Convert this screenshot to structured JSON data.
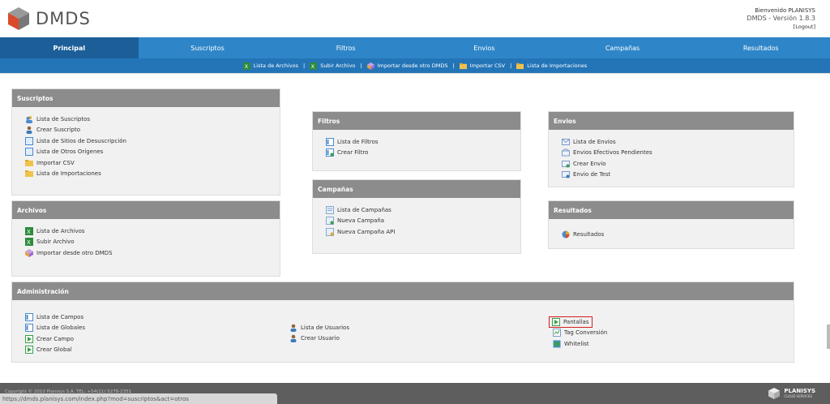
{
  "header": {
    "app_name": "DMDS",
    "welcome": "Bienvenido PLANISYS",
    "version": "DMDS - Versión 1.8.3",
    "logout": "[Logout]"
  },
  "tabs": [
    {
      "label": "Principal",
      "active": true
    },
    {
      "label": "Suscriptos"
    },
    {
      "label": "Filtros"
    },
    {
      "label": "Envios"
    },
    {
      "label": "Campañas"
    },
    {
      "label": "Resultados"
    }
  ],
  "subnav": [
    {
      "label": "Lista de Archivos",
      "icon": "excel-icon"
    },
    {
      "label": "Subir Archivo",
      "icon": "excel-upload-icon"
    },
    {
      "label": "Importar desde otro DMDS",
      "icon": "box-icon"
    },
    {
      "label": "Importar CSV",
      "icon": "folder-icon"
    },
    {
      "label": "Lista de Importaciones",
      "icon": "folder-icon"
    }
  ],
  "suscriptos": {
    "title": "Suscriptos",
    "items": [
      "Lista de Suscriptos",
      "Crear Suscripto",
      "Lista de Sitios de Desuscripción",
      "Lista de Otros Orígenes",
      "Importar CSV",
      "Lista de Importaciones"
    ]
  },
  "archivos": {
    "title": "Archivos",
    "items": [
      "Lista de Archivos",
      "Subir Archivo",
      "Importar desde otro DMDS"
    ]
  },
  "filtros": {
    "title": "Filtros",
    "items": [
      "Lista de Filtros",
      "Crear Filtro"
    ]
  },
  "campanas": {
    "title": "Campañas",
    "items": [
      "Lista de Campañas",
      "Nueva Campaña",
      "Nueva Campaña API"
    ]
  },
  "envios": {
    "title": "Envios",
    "items": [
      "Lista de Envios",
      "Envios Efectivos Pendientes",
      "Crear Envio",
      "Envio de Test"
    ]
  },
  "resultados": {
    "title": "Resultados",
    "items": [
      "Resultados"
    ]
  },
  "administracion": {
    "title": "Administración",
    "col1": [
      "Lista de Campos",
      "Lista de Globales",
      "Crear Campo",
      "Crear Global"
    ],
    "col2": [
      "Lista de Usuarios",
      "Crear Usuario"
    ],
    "col3": [
      "Pantallas",
      "Tag Conversión",
      "Whitelist"
    ]
  },
  "footer": {
    "copyright": "Copyright © 2010 Planisys S.A. TEL: +54(11) 5278-2351",
    "status_url": "https://dmds.planisys.com/index.php?mod=suscriptos&act=otros",
    "brand": "PLANISYS",
    "brand_sub": "CLOUD SERVICES"
  },
  "colors": {
    "tab_bar": "#2e86c8",
    "tab_active": "#1c5f98",
    "panel_head": "#8c8c8c",
    "highlight": "#d61f1f"
  }
}
